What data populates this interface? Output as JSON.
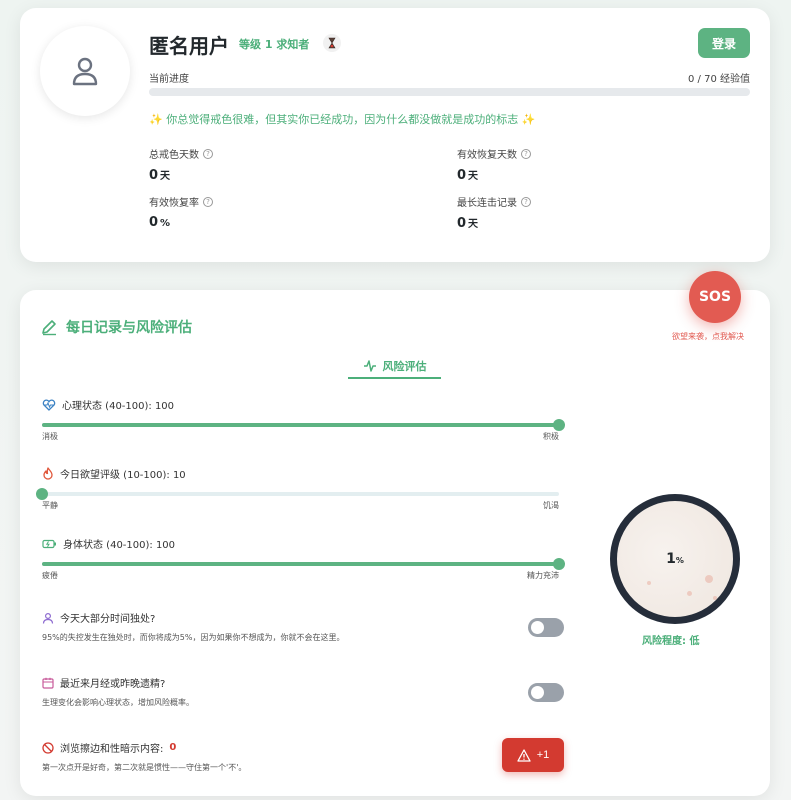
{
  "profile": {
    "username": "匿名用户",
    "level": "等级 1 求知者",
    "login_label": "登录",
    "progress_label": "当前进度",
    "progress_value": "0 / 70 经验值",
    "progress_fraction": 0,
    "motto": "✨ 你总觉得戒色很难，但其实你已经成功，因为什么都没做就是成功的标志 ✨",
    "stats": [
      {
        "label": "总戒色天数",
        "value": "0",
        "unit": "天"
      },
      {
        "label": "有效恢复天数",
        "value": "0",
        "unit": "天"
      },
      {
        "label": "有效恢复率",
        "value": "0",
        "unit": "%"
      },
      {
        "label": "最长连击记录",
        "value": "0",
        "unit": "天"
      }
    ]
  },
  "sos": {
    "label": "SOS",
    "tip": "欲望来袭，点我解决"
  },
  "daily": {
    "title": "每日记录与风险评估",
    "tab_label": "风险评估",
    "sliders": [
      {
        "label": "心理状态 (40-100): 100",
        "min_label": "消极",
        "max_label": "积极",
        "fraction": 1.0,
        "icon": "heart-pulse-icon",
        "color": "#3b82c4"
      },
      {
        "label": "今日欲望评级 (10-100): 10",
        "min_label": "平静",
        "max_label": "饥渴",
        "fraction": 0.0,
        "icon": "flame-icon",
        "color": "#e0573b"
      },
      {
        "label": "身体状态 (40-100): 100",
        "min_label": "疲倦",
        "max_label": "精力充沛",
        "fraction": 1.0,
        "icon": "battery-icon",
        "color": "#4caf7a"
      }
    ],
    "toggles": [
      {
        "label": "今天大部分时间独处?",
        "desc": "95%的失控发生在独处时，而你将成为5%，因为如果你不想成为，你就不会在这里。",
        "on": false
      },
      {
        "label": "最近来月经或昨晚遗精?",
        "desc": "生理变化会影响心理状态，增加风险概率。",
        "on": false
      }
    ],
    "browse": {
      "label": "浏览擦边和性暗示内容:",
      "count": "0",
      "desc": "第一次点开是好奇，第二次就是惯性——守住第一个'不'。",
      "button_label": "+1"
    },
    "risk": {
      "value": "1",
      "unit": "%",
      "label": "风险程度: 低"
    }
  }
}
